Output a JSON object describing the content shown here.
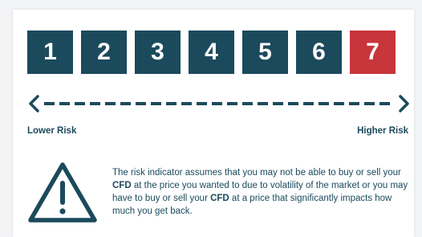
{
  "risk_scale": {
    "levels": [
      "1",
      "2",
      "3",
      "4",
      "5",
      "6",
      "7"
    ],
    "selected_level": "7",
    "color_default": "#1b4a5c",
    "color_selected": "#c8353b"
  },
  "labels": {
    "lower_risk": "Lower Risk",
    "higher_risk": "Higher Risk"
  },
  "notice": {
    "icon": "warning-triangle-icon",
    "text_1": "The risk indicator assumes that you may not be able to buy or sell your ",
    "bold_1": "CFD",
    "text_2": " at the price you wanted to due to volatility of the market or you may have to buy or sell your ",
    "bold_2": "CFD",
    "text_3": " at a price that significantly impacts how much you get back."
  }
}
